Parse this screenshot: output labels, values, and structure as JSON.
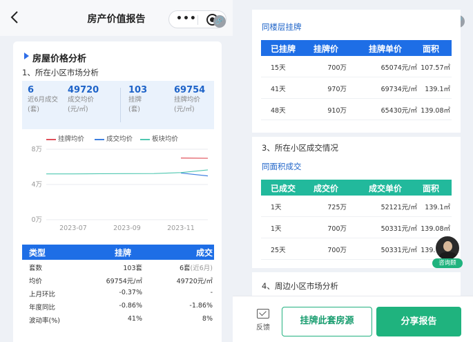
{
  "header": {
    "title": "房产价值报告",
    "more_icon_text": "•••"
  },
  "left_card": {
    "section_title": "房屋价格分析",
    "subtitle": "1、所在小区市场分析",
    "stats": [
      {
        "value": "6",
        "label1": "近6月成交",
        "label2": "(套)"
      },
      {
        "value": "49720",
        "label1": "成交均价",
        "label2": "(元/㎡)"
      },
      {
        "value": "103",
        "label1": "挂牌",
        "label2": "(套)"
      },
      {
        "value": "69754",
        "label1": "挂牌均价",
        "label2": "(元/㎡)"
      }
    ],
    "table": {
      "headers": [
        "类型",
        "挂牌",
        "成交"
      ],
      "rows": [
        {
          "label": "套数",
          "listing": "103套",
          "deal": "6套",
          "deal_note": "(近6月)"
        },
        {
          "label": "均价",
          "listing": "69754元/㎡",
          "deal": "49720元/㎡",
          "deal_note": ""
        },
        {
          "label": "上月环比",
          "listing": "-0.37%",
          "deal": "-",
          "deal_note": ""
        },
        {
          "label": "年度同比",
          "listing": "-0.86%",
          "deal": "-1.86%",
          "deal_note": ""
        },
        {
          "label": "波动率(%)",
          "listing": "41%",
          "deal": "8%",
          "deal_note": ""
        }
      ]
    }
  },
  "chart_data": {
    "type": "line",
    "x": [
      "2023-06",
      "2023-07",
      "2023-08",
      "2023-09",
      "2023-10",
      "2023-11",
      "2023-12"
    ],
    "xticks": [
      "2023-07",
      "2023-09",
      "2023-11"
    ],
    "yticks": [
      "8万",
      "4万",
      "0万"
    ],
    "ylim": [
      0,
      80000
    ],
    "series": [
      {
        "name": "挂牌均价",
        "color": "#e0505a",
        "values": [
          null,
          null,
          null,
          null,
          null,
          70000,
          69754
        ]
      },
      {
        "name": "成交均价",
        "color": "#3d7fe0",
        "values": [
          null,
          null,
          null,
          null,
          null,
          53000,
          49720
        ]
      },
      {
        "name": "板块均价",
        "color": "#4fc7b0",
        "values": [
          52000,
          52000,
          52200,
          52300,
          52400,
          53500,
          56500
        ]
      }
    ]
  },
  "right_card1": {
    "heading": "同楼层挂牌",
    "headers": [
      "已挂牌",
      "挂牌价",
      "挂牌单价",
      "面积"
    ],
    "rows": [
      [
        "15天",
        "700万",
        "65074元/㎡",
        "107.57㎡"
      ],
      [
        "41天",
        "970万",
        "69734元/㎡",
        "139.1㎡"
      ],
      [
        "48天",
        "910万",
        "65430元/㎡",
        "139.08㎡"
      ]
    ]
  },
  "right_card2": {
    "section": "3、所在小区成交情况",
    "heading": "同面积成交",
    "headers": [
      "已成交",
      "成交价",
      "成交单价",
      "面积"
    ],
    "rows": [
      [
        "1天",
        "725万",
        "52121元/㎡",
        "139.1㎡"
      ],
      [
        "1天",
        "700万",
        "50331元/㎡",
        "139.08㎡"
      ],
      [
        "25天",
        "700万",
        "50331元/㎡",
        "139.08㎡"
      ]
    ]
  },
  "right_card3": {
    "section": "4、周边小区市场分析"
  },
  "bottom_bar": {
    "feedback": "反馈",
    "list_button": "挂牌此套房源",
    "share_button": "分享报告"
  },
  "advisor": {
    "label": "咨询顾"
  },
  "colors": {
    "primary_blue": "#1e6ee6",
    "teal": "#1fb37e",
    "table_teal": "#22b99c"
  }
}
